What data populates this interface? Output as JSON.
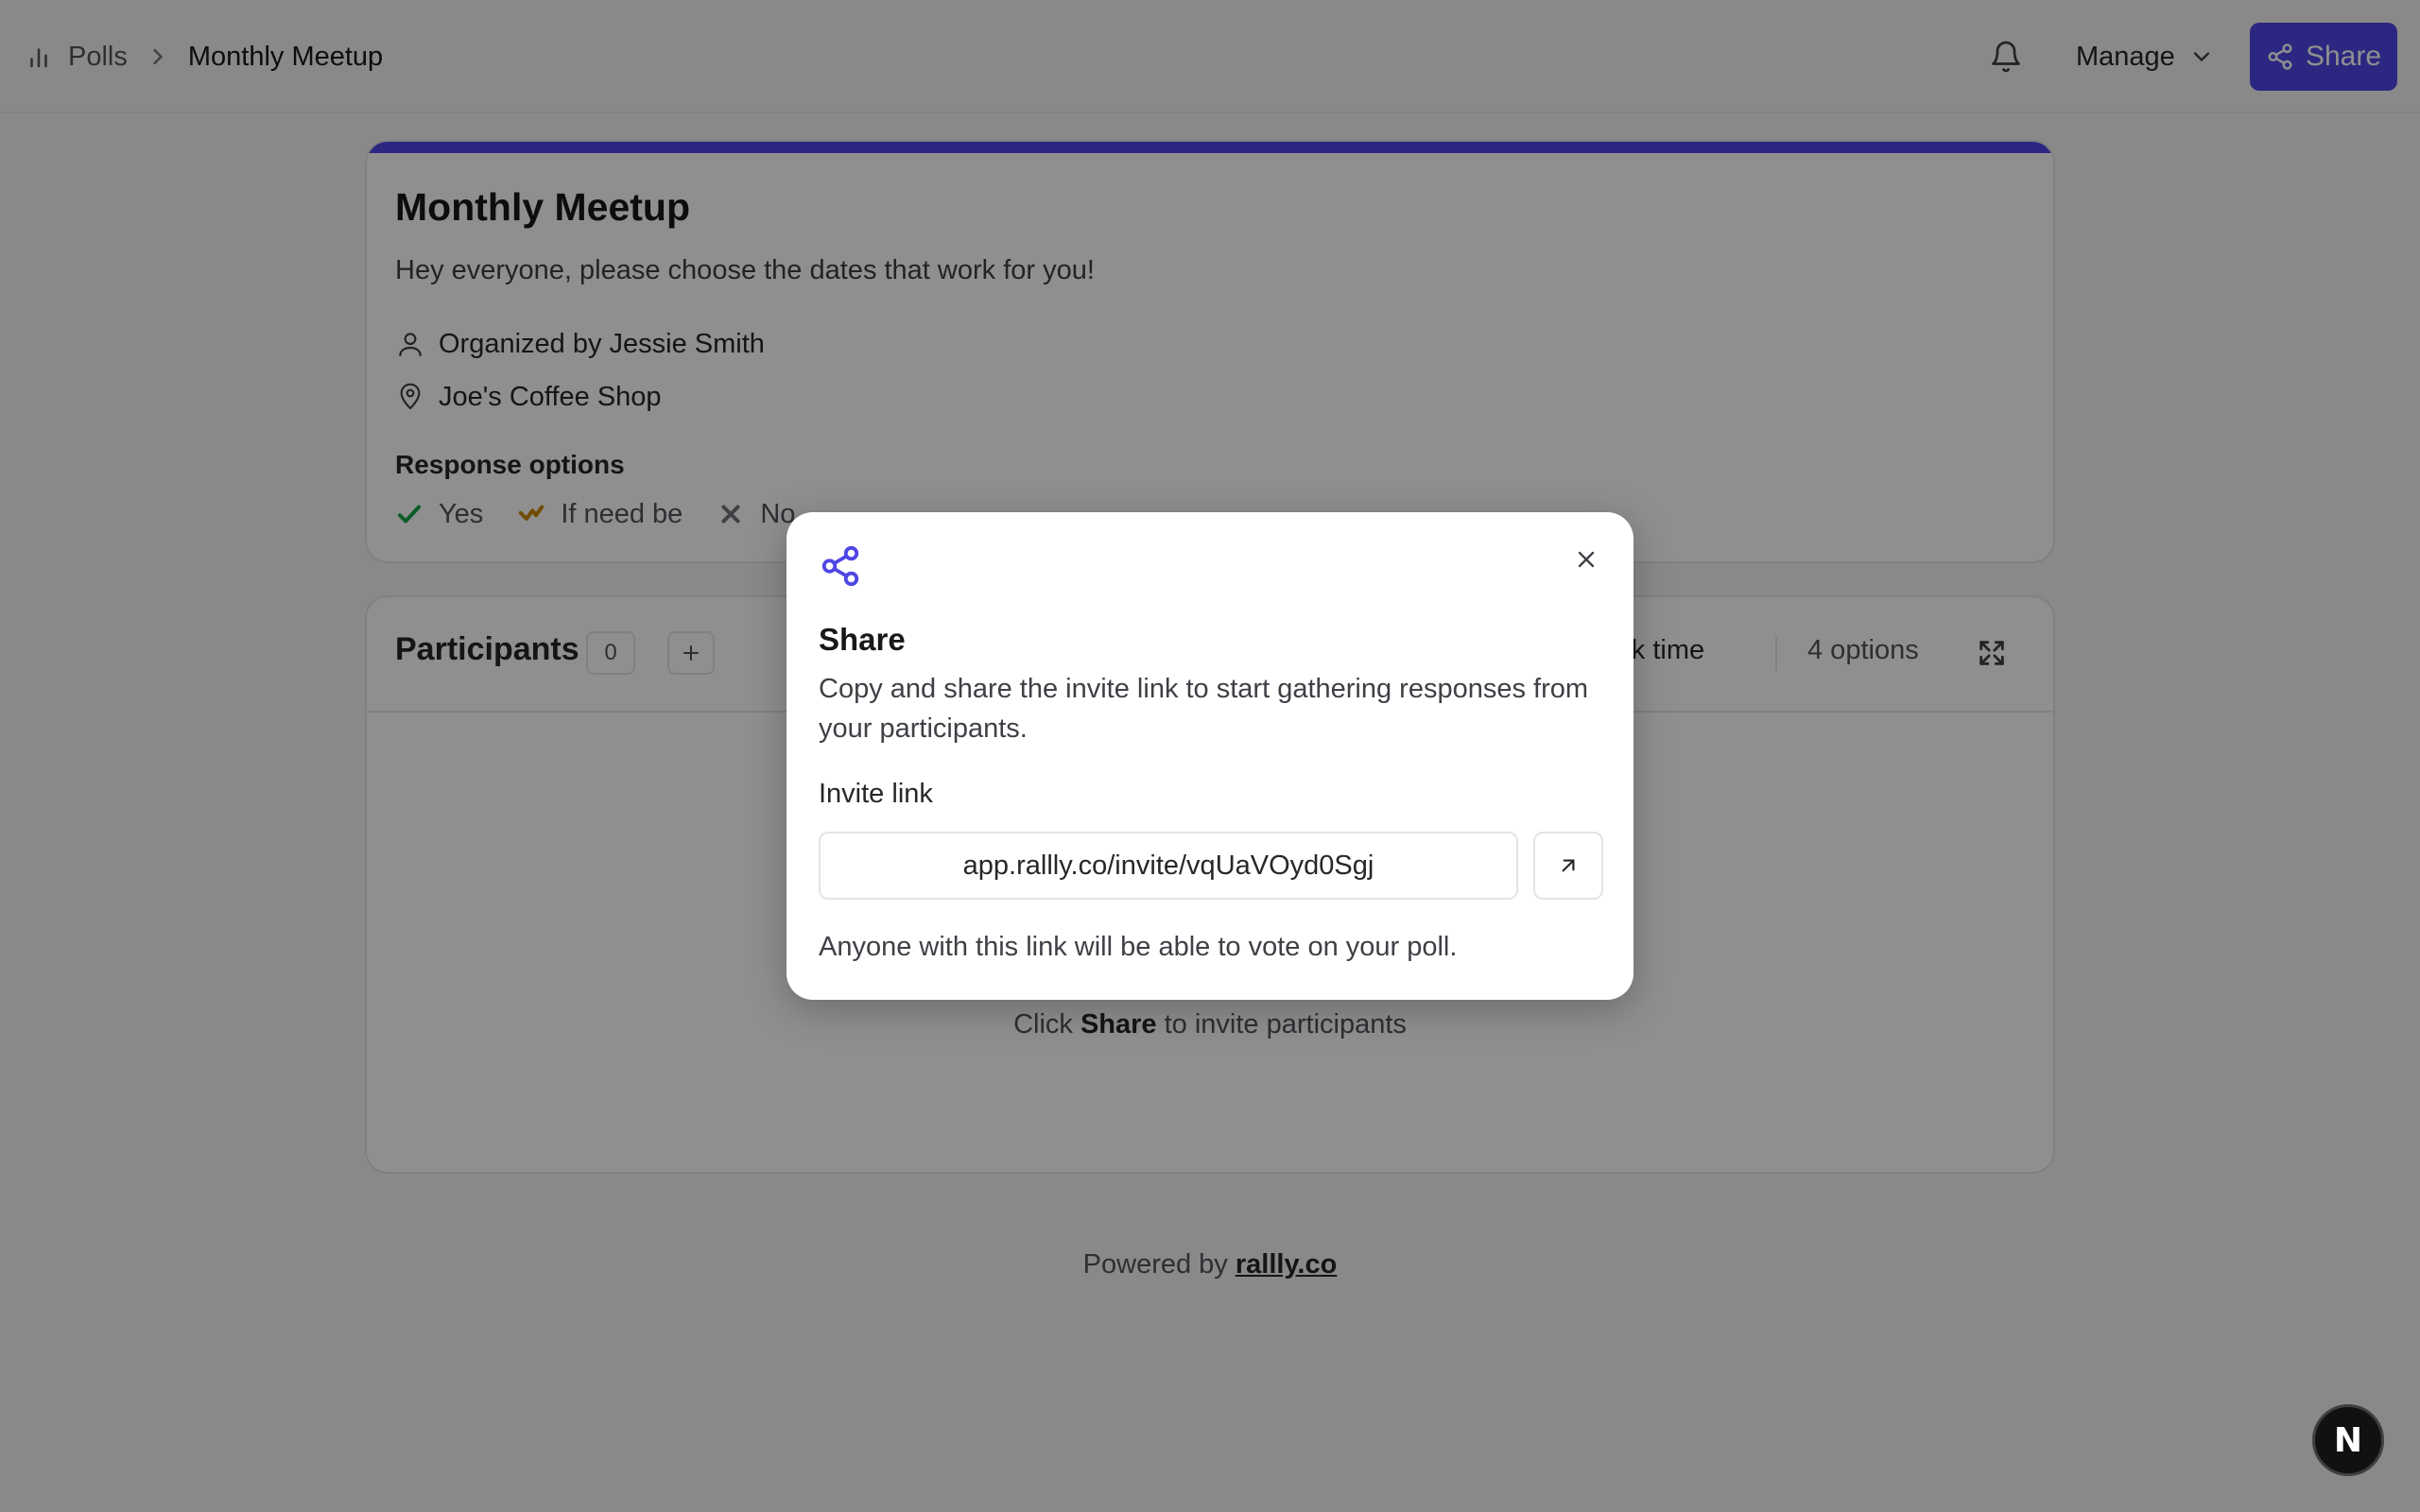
{
  "header": {
    "breadcrumb_root": "Polls",
    "breadcrumb_current": "Monthly Meetup",
    "manage_label": "Manage",
    "share_label": "Share"
  },
  "poll": {
    "title": "Monthly Meetup",
    "description": "Hey everyone, please choose the dates that work for you!",
    "organizer": "Organized by Jessie Smith",
    "location": "Joe's Coffee Shop",
    "response_options_label": "Response options",
    "responses": [
      {
        "label": "Yes",
        "icon": "check-icon",
        "color": "#16a34a"
      },
      {
        "label": "If need be",
        "icon": "if-need-be-icon",
        "color": "#ca8a04"
      },
      {
        "label": "No",
        "icon": "x-icon",
        "color": "#71717a"
      }
    ]
  },
  "participants": {
    "label": "Participants",
    "count": "0",
    "time_label": "ork time",
    "options_label": "4 options",
    "empty_prefix": "Click ",
    "empty_bold": "Share",
    "empty_suffix": " to invite participants"
  },
  "footer": {
    "prefix": "Powered by ",
    "link": "rallly.co"
  },
  "dialog": {
    "title": "Share",
    "description": "Copy and share the invite link to start gathering responses from your participants.",
    "invite_label": "Invite link",
    "invite_value": "app.rallly.co/invite/vqUaVOyd0Sgj",
    "note": "Anyone with this link will be able to vote on your poll."
  },
  "badge": {
    "letter": "N"
  },
  "colors": {
    "accent": "#4f46e5"
  }
}
